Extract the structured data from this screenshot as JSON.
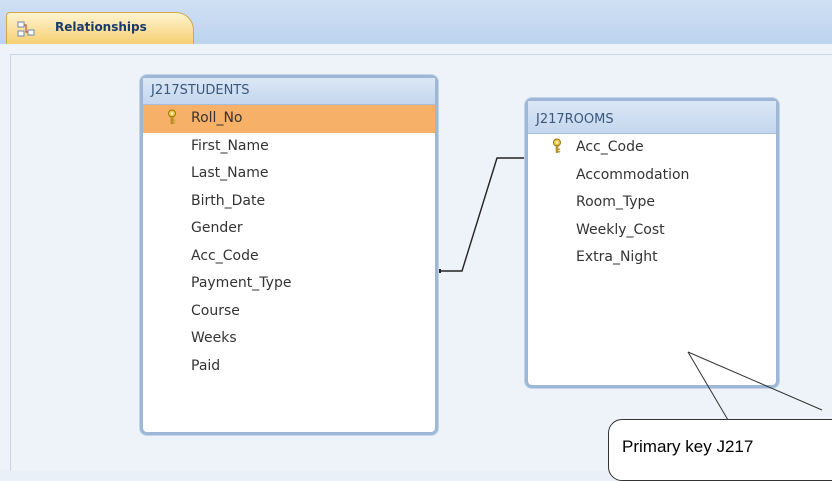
{
  "tab": {
    "label": "Relationships",
    "icon": "relationships-icon"
  },
  "tables": [
    {
      "name": "J217STUDENTS",
      "fields": [
        {
          "label": "Roll_No",
          "primary_key": true,
          "selected": true
        },
        {
          "label": "First_Name",
          "primary_key": false,
          "selected": false
        },
        {
          "label": "Last_Name",
          "primary_key": false,
          "selected": false
        },
        {
          "label": "Birth_Date",
          "primary_key": false,
          "selected": false
        },
        {
          "label": "Gender",
          "primary_key": false,
          "selected": false
        },
        {
          "label": "Acc_Code",
          "primary_key": false,
          "selected": false
        },
        {
          "label": "Payment_Type",
          "primary_key": false,
          "selected": false
        },
        {
          "label": "Course",
          "primary_key": false,
          "selected": false
        },
        {
          "label": "Weeks",
          "primary_key": false,
          "selected": false
        },
        {
          "label": "Paid",
          "primary_key": false,
          "selected": false
        }
      ]
    },
    {
      "name": "J217ROOMS",
      "fields": [
        {
          "label": "Acc_Code",
          "primary_key": true,
          "selected": false
        },
        {
          "label": "Accommodation",
          "primary_key": false,
          "selected": false
        },
        {
          "label": "Room_Type",
          "primary_key": false,
          "selected": false
        },
        {
          "label": "Weekly_Cost",
          "primary_key": false,
          "selected": false
        },
        {
          "label": "Extra_Night",
          "primary_key": false,
          "selected": false
        }
      ]
    }
  ],
  "relationship": {
    "from": "J217STUDENTS.Acc_Code",
    "to": "J217ROOMS.Acc_Code"
  },
  "callout": {
    "text": "Primary key J217"
  },
  "colors": {
    "selected_row": "#f6b067",
    "table_border": "#9db7d6",
    "tab": "#f6cf72"
  }
}
